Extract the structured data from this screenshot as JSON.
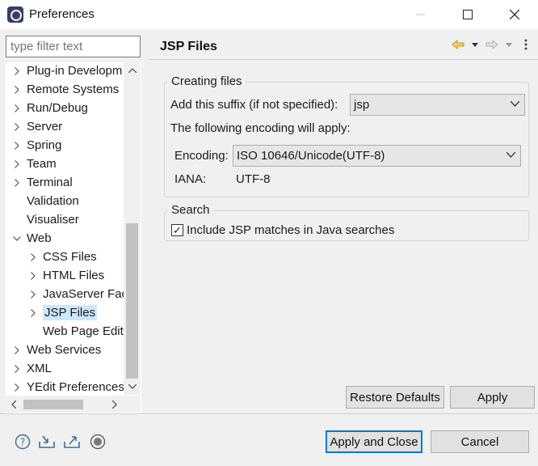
{
  "window": {
    "title": "Preferences"
  },
  "filter": {
    "placeholder": "type filter text"
  },
  "tree": {
    "items": [
      {
        "label": "Plug-in Developm",
        "expander": "collapsed",
        "level": 0
      },
      {
        "label": "Remote Systems",
        "expander": "collapsed",
        "level": 0
      },
      {
        "label": "Run/Debug",
        "expander": "collapsed",
        "level": 0
      },
      {
        "label": "Server",
        "expander": "collapsed",
        "level": 0
      },
      {
        "label": "Spring",
        "expander": "collapsed",
        "level": 0
      },
      {
        "label": "Team",
        "expander": "collapsed",
        "level": 0
      },
      {
        "label": "Terminal",
        "expander": "collapsed",
        "level": 0
      },
      {
        "label": "Validation",
        "expander": "none",
        "level": 0
      },
      {
        "label": "Visualiser",
        "expander": "none",
        "level": 0
      },
      {
        "label": "Web",
        "expander": "expanded",
        "level": 0
      },
      {
        "label": "CSS Files",
        "expander": "collapsed",
        "level": 1
      },
      {
        "label": "HTML Files",
        "expander": "collapsed",
        "level": 1
      },
      {
        "label": "JavaServer Face",
        "expander": "collapsed",
        "level": 1
      },
      {
        "label": "JSP Files",
        "expander": "collapsed",
        "level": 1,
        "selected": true
      },
      {
        "label": "Web Page Edit",
        "expander": "none",
        "level": 1
      },
      {
        "label": "Web Services",
        "expander": "collapsed",
        "level": 0
      },
      {
        "label": "XML",
        "expander": "collapsed",
        "level": 0
      },
      {
        "label": "YEdit Preferences",
        "expander": "collapsed",
        "level": 0
      }
    ]
  },
  "page": {
    "title": "JSP Files"
  },
  "creating": {
    "title": "Creating files",
    "suffix_label": "Add this suffix (if not specified):",
    "suffix_value": "jsp",
    "encoding_intro": "The following encoding will apply:",
    "encoding_label": "Encoding:",
    "encoding_value": "ISO 10646/Unicode(UTF-8)",
    "iana_label": "IANA:",
    "iana_value": "UTF-8"
  },
  "search": {
    "title": "Search",
    "include_label": "Include JSP matches in Java searches",
    "include_checked": true,
    "check_glyph": "✓"
  },
  "buttons": {
    "restore_defaults": "Restore Defaults",
    "apply": "Apply",
    "apply_close": "Apply and Close",
    "cancel": "Cancel"
  },
  "icons": {
    "back": "back-arrow-icon",
    "forward": "forward-arrow-icon",
    "menu": "view-menu-icon",
    "help": "help-icon",
    "import": "import-icon",
    "export": "export-icon",
    "record": "record-icon"
  },
  "colors": {
    "selection": "#cce8ff",
    "default_button_border": "#0078d7",
    "back_arrow": "#e8b23a"
  }
}
